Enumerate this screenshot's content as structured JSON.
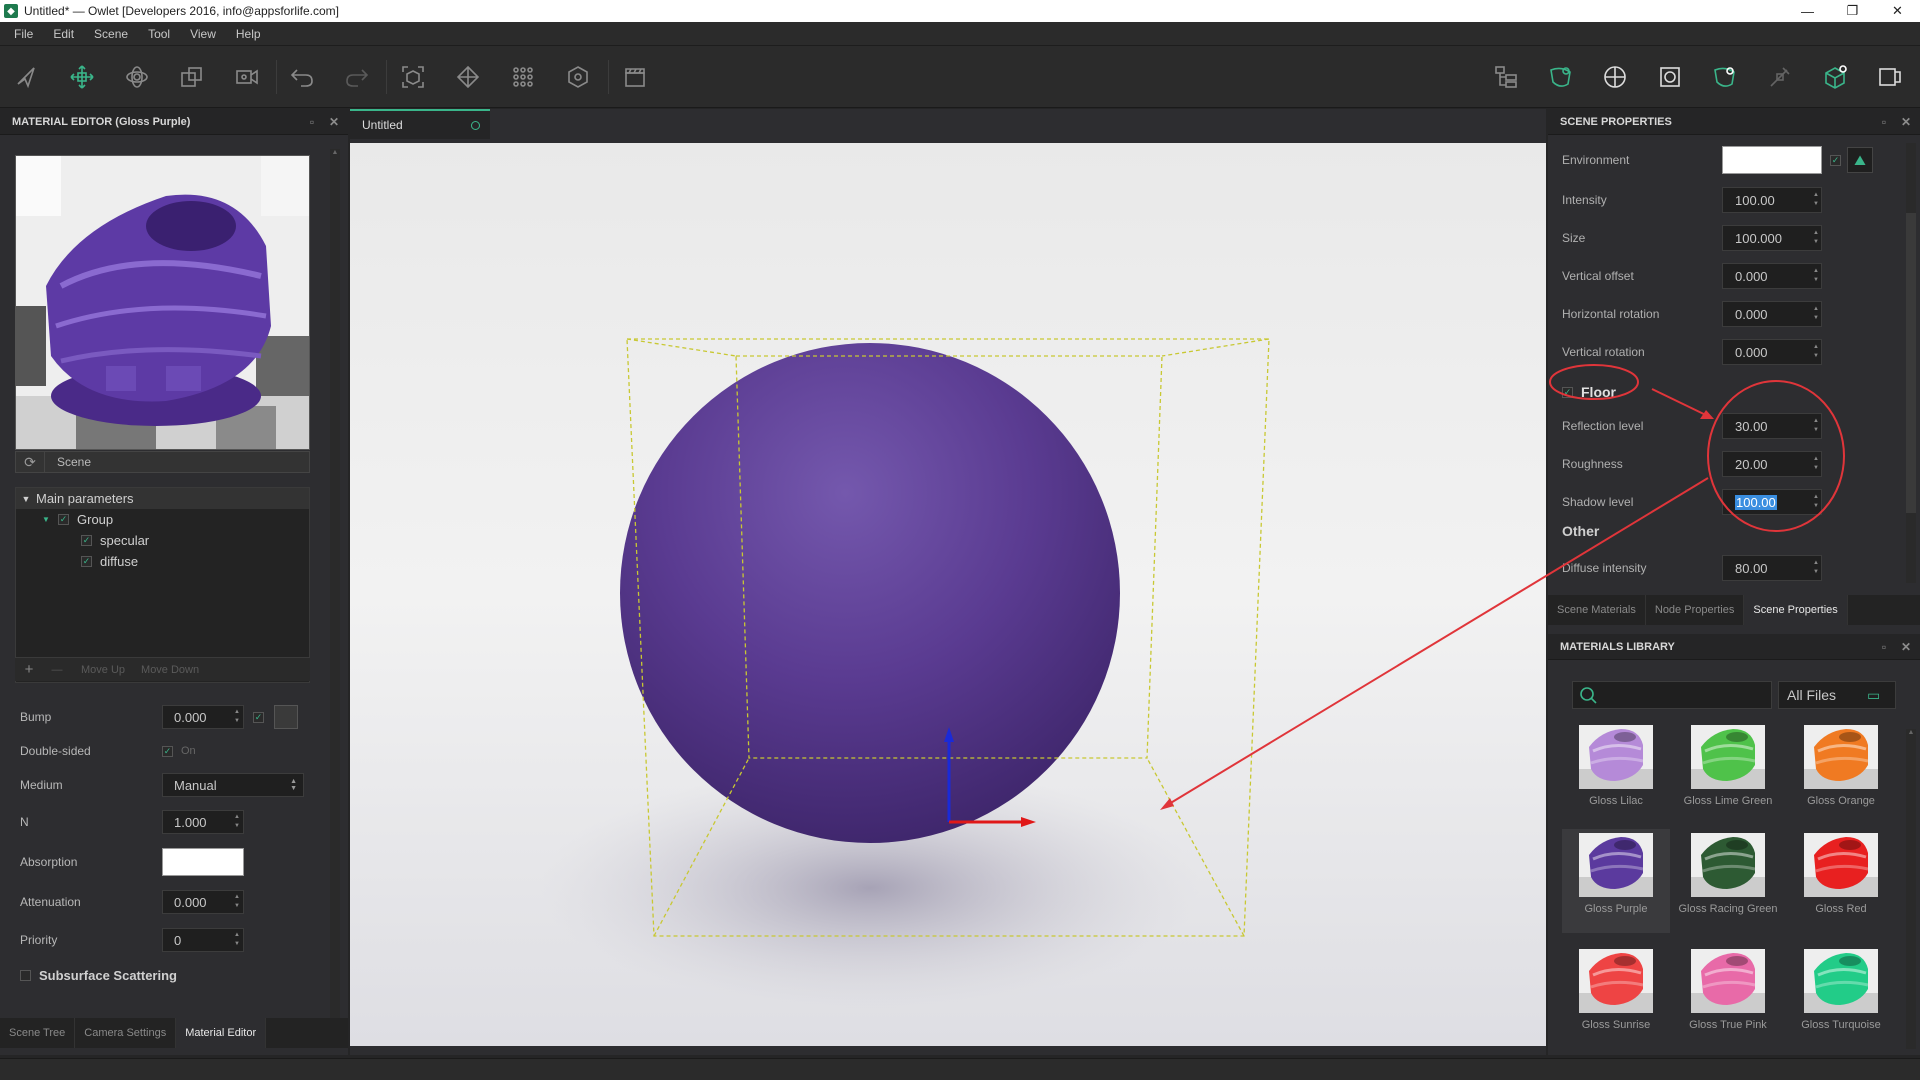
{
  "window": {
    "title": "Untitled* — Owlet [Developers 2016, info@appsforlife.com]",
    "minimize": "—",
    "maximize": "❐",
    "close": "✕"
  },
  "menu": [
    "File",
    "Edit",
    "Scene",
    "Tool",
    "View",
    "Help"
  ],
  "toolbar": {
    "left_icons": [
      "select-icon",
      "move-icon",
      "rotate-icon",
      "scale-icon",
      "camera-icon",
      "undo-icon",
      "redo-icon",
      "frame-selected-icon",
      "snap-icon",
      "grid-icon",
      "pivot-icon",
      "clapper-icon"
    ],
    "right_icons": [
      "scene-tree-icon",
      "material-settings-icon",
      "globe-icon",
      "render-icon",
      "material-preview-icon",
      "light-icon",
      "object-settings-icon",
      "output-icon"
    ]
  },
  "material_editor": {
    "title": "MATERIAL EDITOR (Gloss Purple)",
    "preview_label": "Scene",
    "tree": {
      "header": "Main parameters",
      "group": "Group",
      "children": [
        "specular",
        "diffuse"
      ]
    },
    "tree_footer": {
      "add": "+",
      "remove": "—",
      "move_up": "Move Up",
      "move_down": "Move Down"
    },
    "properties": {
      "bump_label": "Bump",
      "bump_value": "0.000",
      "double_sided_label": "Double-sided",
      "double_sided_value": "On",
      "medium_label": "Medium",
      "medium_value": "Manual",
      "n_label": "N",
      "n_value": "1.000",
      "absorption_label": "Absorption",
      "attenuation_label": "Attenuation",
      "attenuation_value": "0.000",
      "priority_label": "Priority",
      "priority_value": "0",
      "subsurface_label": "Subsurface Scattering"
    },
    "tabs": [
      "Scene Tree",
      "Camera Settings",
      "Material Editor"
    ],
    "active_tab": "Material Editor"
  },
  "viewport": {
    "tab_label": "Untitled"
  },
  "scene_properties": {
    "title": "SCENE PROPERTIES",
    "environment_label": "Environment",
    "intensity_label": "Intensity",
    "intensity_value": "100.00",
    "size_label": "Size",
    "size_value": "100.000",
    "vertical_offset_label": "Vertical offset",
    "vertical_offset_value": "0.000",
    "horizontal_rotation_label": "Horizontal rotation",
    "horizontal_rotation_value": "0.000",
    "vertical_rotation_label": "Vertical rotation",
    "vertical_rotation_value": "0.000",
    "floor_label": "Floor",
    "reflection_level_label": "Reflection level",
    "reflection_level_value": "30.00",
    "roughness_label": "Roughness",
    "roughness_value": "20.00",
    "shadow_level_label": "Shadow level",
    "shadow_level_value": "100.00",
    "other_label": "Other",
    "diffuse_intensity_label": "Diffuse intensity",
    "diffuse_intensity_value": "80.00",
    "tabs": [
      "Scene Materials",
      "Node Properties",
      "Scene Properties"
    ],
    "active_tab": "Scene Properties"
  },
  "materials_library": {
    "title": "MATERIALS LIBRARY",
    "filter": "All Files",
    "items": [
      {
        "name": "Gloss Lilac",
        "color": "#b58ad8"
      },
      {
        "name": "Gloss Lime Green",
        "color": "#4fc24a"
      },
      {
        "name": "Gloss Orange",
        "color": "#f07a22"
      },
      {
        "name": "Gloss Purple",
        "color": "#5b3a9e"
      },
      {
        "name": "Gloss Racing Green",
        "color": "#2d5a33"
      },
      {
        "name": "Gloss Red",
        "color": "#e82020"
      },
      {
        "name": "Gloss Sunrise",
        "color": "#ee4444"
      },
      {
        "name": "Gloss True Pink",
        "color": "#e86aa8"
      },
      {
        "name": "Gloss Turquoise",
        "color": "#22cc88"
      }
    ],
    "selected": "Gloss Purple"
  },
  "colors": {
    "accent": "#3ab58a",
    "annotation": "#e0353a",
    "sphere": "#5a3b91"
  }
}
